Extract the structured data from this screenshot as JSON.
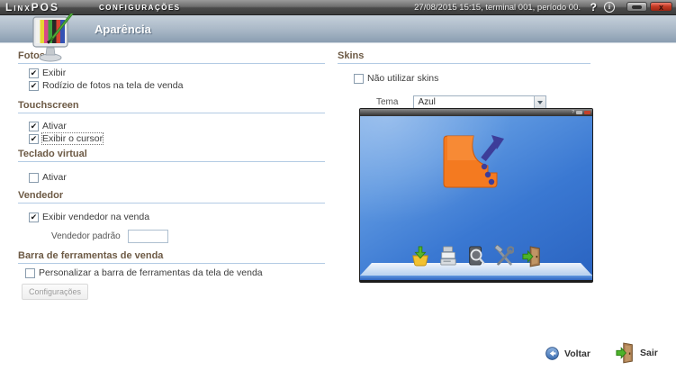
{
  "titlebar": {
    "logo": "LinxPOS",
    "title": "Configurações",
    "session_info": "27/08/2015 15:15, terminal 001, período 00.",
    "help_label": "?",
    "info_label": "i",
    "close_label": "x"
  },
  "header": {
    "title": "Aparência"
  },
  "sections": {
    "fotos": {
      "title": "Fotos",
      "exibir": {
        "label": "Exibir",
        "checked": true
      },
      "rodizio": {
        "label": "Rodízio de fotos na tela de venda",
        "checked": true
      }
    },
    "touchscreen": {
      "title": "Touchscreen",
      "ativar": {
        "label": "Ativar",
        "checked": true
      },
      "exibir_cursor": {
        "label": "Exibir o cursor",
        "checked": true,
        "focused": true
      }
    },
    "teclado_virtual": {
      "title": "Teclado virtual",
      "ativar": {
        "label": "Ativar",
        "checked": false
      }
    },
    "vendedor": {
      "title": "Vendedor",
      "exibir_vendedor": {
        "label": "Exibir vendedor na venda",
        "checked": true
      },
      "vendedor_padrao": {
        "label": "Vendedor padrão",
        "value": ""
      }
    },
    "barra_ferramentas": {
      "title": "Barra de ferramentas de venda",
      "personalizar": {
        "label": "Personalizar a barra de ferramentas da tela de venda",
        "checked": false
      },
      "config_button_label": "Configurações"
    },
    "skins": {
      "title": "Skins",
      "nao_utilizar": {
        "label": "Não utilizar skins",
        "checked": false
      },
      "tema": {
        "label": "Tema",
        "value": "Azul"
      }
    }
  },
  "preview": {
    "help_label": "?",
    "dock_icons": [
      "basket",
      "cash-register",
      "search-device",
      "tools",
      "exit-door"
    ]
  },
  "footer": {
    "voltar": "Voltar",
    "sair": "Sair"
  },
  "colors": {
    "close_button_red": "#c53a24",
    "header_gradient_top": "#c6d0da",
    "header_gradient_bottom": "#8a9db1",
    "section_title_brown": "#6d5a45",
    "rule_blue": "#b3cbe4",
    "preview_blue": "#3a78d2",
    "logo_orange": "#f47a20",
    "logo_purple": "#3d3d99"
  }
}
